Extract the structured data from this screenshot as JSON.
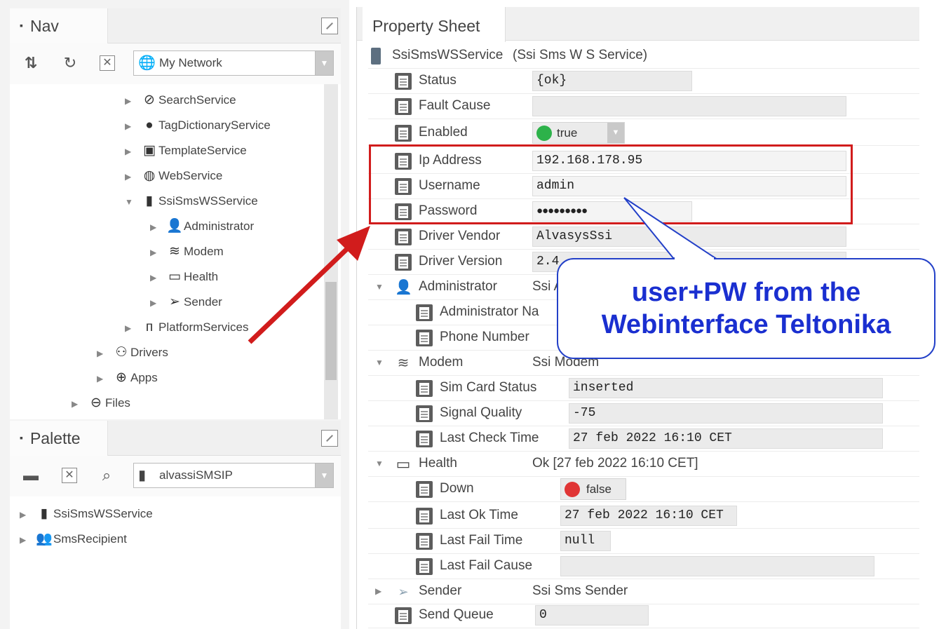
{
  "nav": {
    "title": "Nav",
    "network": "My Network",
    "tree": [
      {
        "label": "SearchService"
      },
      {
        "label": "TagDictionaryService"
      },
      {
        "label": "TemplateService"
      },
      {
        "label": "WebService"
      },
      {
        "label": "SsiSmsWSService"
      },
      {
        "label": "Administrator"
      },
      {
        "label": "Modem"
      },
      {
        "label": "Health"
      },
      {
        "label": "Sender"
      },
      {
        "label": "PlatformServices"
      },
      {
        "label": "Drivers"
      },
      {
        "label": "Apps"
      },
      {
        "label": "Files"
      }
    ]
  },
  "palette": {
    "title": "Palette",
    "module": "alvassiSMSIP",
    "items": [
      {
        "label": "SsiSmsWSService"
      },
      {
        "label": "SmsRecipient"
      }
    ]
  },
  "property_sheet": {
    "tab": "Property Sheet",
    "component_name": "SsiSmsWSService",
    "component_type": "(Ssi Sms W S Service)",
    "rows": {
      "status": {
        "label": "Status",
        "value": "{ok}"
      },
      "fault_cause": {
        "label": "Fault Cause",
        "value": ""
      },
      "enabled": {
        "label": "Enabled",
        "value": "true"
      },
      "ip_address": {
        "label": "Ip Address",
        "value": "192.168.178.95"
      },
      "username": {
        "label": "Username",
        "value": "admin"
      },
      "password": {
        "label": "Password",
        "value": "●●●●●●●●●"
      },
      "driver_vendor": {
        "label": "Driver Vendor",
        "value": "AlvasysSsi"
      },
      "driver_version": {
        "label": "Driver Version",
        "value": "2.4"
      },
      "administrator": {
        "label": "Administrator",
        "value": "Ssi A"
      },
      "administrator_name": {
        "label": "Administrator Na"
      },
      "phone_number": {
        "label": "Phone Number"
      },
      "modem": {
        "label": "Modem",
        "value": "Ssi Modem"
      },
      "sim_card_status": {
        "label": "Sim Card Status",
        "value": "inserted"
      },
      "signal_quality": {
        "label": "Signal Quality",
        "value": "-75"
      },
      "last_check_time": {
        "label": "Last Check Time",
        "value": "27 feb 2022 16:10 CET"
      },
      "health": {
        "label": "Health",
        "value": "Ok [27 feb 2022 16:10 CET]"
      },
      "down": {
        "label": "Down",
        "value": "false"
      },
      "last_ok_time": {
        "label": "Last Ok Time",
        "value": "27 feb 2022 16:10 CET"
      },
      "last_fail_time": {
        "label": "Last Fail Time",
        "value": "null"
      },
      "last_fail_cause": {
        "label": "Last Fail Cause",
        "value": ""
      },
      "sender": {
        "label": "Sender",
        "value": "Ssi Sms Sender"
      },
      "send_queue": {
        "label": "Send Queue",
        "value": "0"
      }
    }
  },
  "annotation": {
    "line1": "user+PW from the",
    "line2": "Webinterface Teltonika",
    "highlight_color": "#d11c1c",
    "callout_color": "#1a2fd0"
  },
  "icons": {
    "sheet": "property-sheet-icon",
    "green_bullet": "#2db24a",
    "red_bullet": "#e03535"
  }
}
